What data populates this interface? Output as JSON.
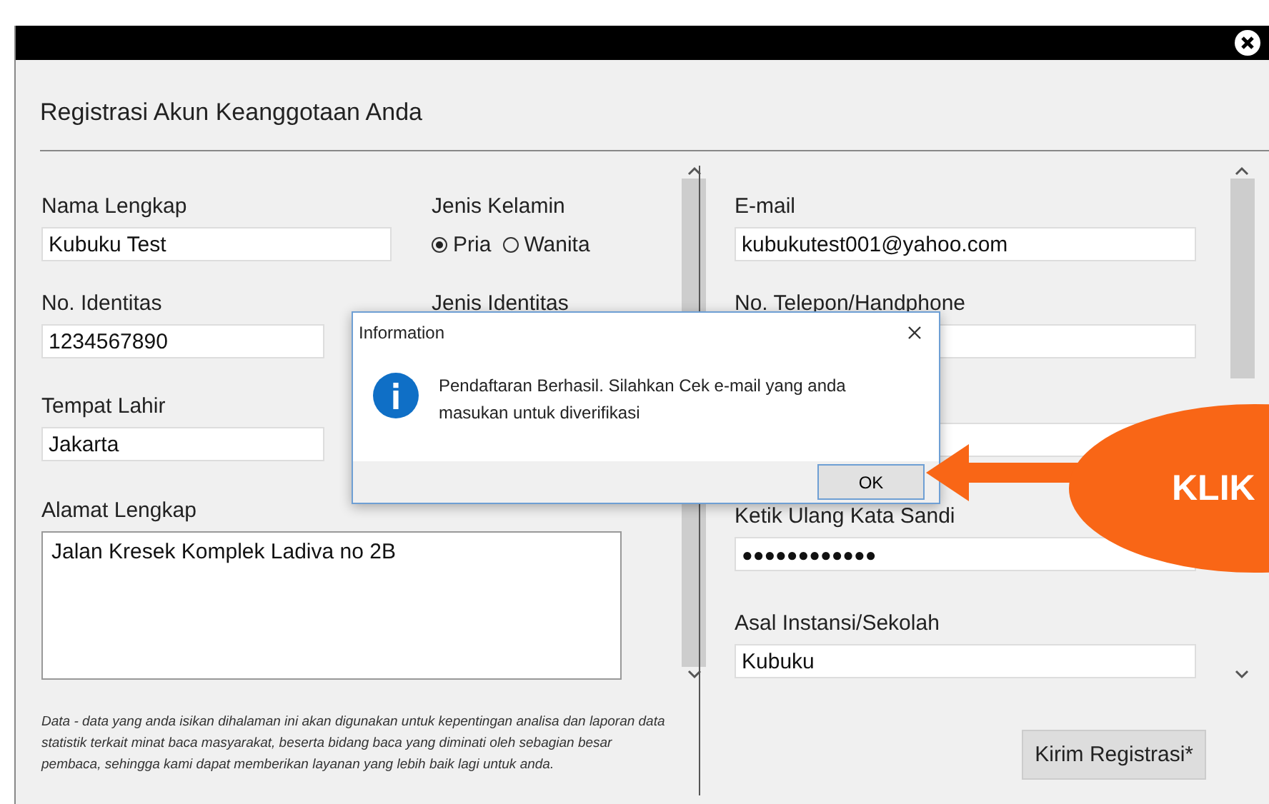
{
  "form": {
    "title": "Registrasi Akun Keanggotaan Anda",
    "left_fields": [
      {
        "kind": "text",
        "label": "Nama Lengkap",
        "value": "Kubuku Test"
      },
      {
        "kind": "text",
        "label": "No. Identitas",
        "value": "1234567890"
      },
      {
        "kind": "text",
        "label": "Tempat Lahir",
        "value": "Jakarta"
      },
      {
        "kind": "textarea",
        "label": "Alamat Lengkap",
        "value": "Jalan Kresek Komplek Ladiva no 2B"
      }
    ],
    "gender": {
      "label": "Jenis Kelamin",
      "options": [
        {
          "label": "Pria",
          "selected": true
        },
        {
          "label": "Wanita",
          "selected": false
        }
      ]
    },
    "id_type": {
      "label": "Jenis Identitas"
    },
    "right_fields": [
      {
        "kind": "text",
        "label": "E-mail",
        "value": "kubukutest001@yahoo.com"
      },
      {
        "kind": "text",
        "label": "No. Telepon/Handphone"
      },
      {
        "kind": "password"
      },
      {
        "kind": "password",
        "label": "Ketik Ulang Kata Sandi",
        "value": "●●●●●●●●●●●●"
      },
      {
        "kind": "text",
        "label": "Asal Instansi/Sekolah",
        "value": "Kubuku"
      }
    ],
    "note": "Data - data yang anda isikan dihalaman ini akan digunakan untuk kepentingan analisa dan laporan data statistik terkait minat baca masyarakat, beserta bidang baca yang diminati oleh sebagian besar pembaca, sehingga kami dapat memberikan layanan yang lebih baik lagi untuk anda.",
    "submit": "Kirim Registrasi*"
  },
  "dialog": {
    "title": "Information",
    "message": "Pendaftaran Berhasil. Silahkan Cek e-mail yang anda masukan untuk diverifikasi",
    "button": "OK"
  },
  "callout": {
    "label": "KLIK"
  }
}
